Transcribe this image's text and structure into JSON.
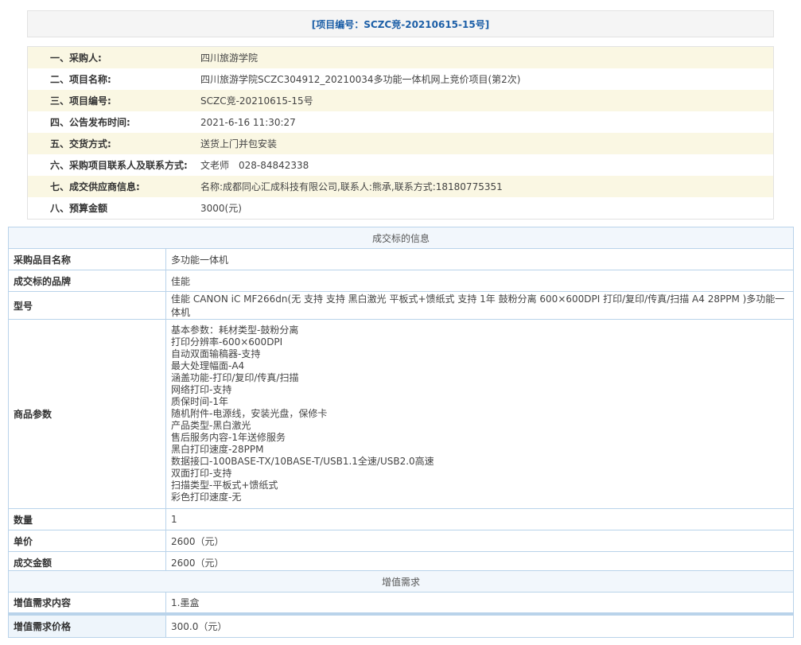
{
  "project_header": "[项目编号：SCZC竞-20210615-15号]",
  "info": [
    {
      "label": "一、采购人:",
      "value": "四川旅游学院"
    },
    {
      "label": "二、项目名称:",
      "value": "四川旅游学院SCZC304912_20210034多功能一体机网上竞价项目(第2次)"
    },
    {
      "label": "三、项目编号:",
      "value": "SCZC竞-20210615-15号"
    },
    {
      "label": "四、公告发布时间:",
      "value": "2021-6-16 11:30:27"
    },
    {
      "label": "五、交货方式:",
      "value": "送货上门并包安装"
    },
    {
      "label": "六、采购项目联系人及联系方式:",
      "value": "文老师　028-84842338"
    },
    {
      "label": "七、成交供应商信息:",
      "value": "名称:成都同心汇成科技有限公司,联系人:熊承,联系方式:18180775351"
    },
    {
      "label": "八、预算金额",
      "value": "3000(元)"
    }
  ],
  "deal": {
    "title": "成交标的信息",
    "item_name_label": "采购品目名称",
    "item_name": "多功能一体机",
    "brand_label": "成交标的品牌",
    "brand": "佳能",
    "model_label": "型号",
    "model": "佳能 CANON iC MF266dn(无 支持 支持 黑白激光 平板式+馈纸式 支持 1年 鼓粉分离 600×600DPI 打印/复印/传真/扫描 A4 28PPM )多功能一体机",
    "params_label": "商品参数",
    "params": [
      "基本参数：耗材类型-鼓粉分离",
      "打印分辨率-600×600DPI",
      "自动双面输稿器-支持",
      "最大处理幅面-A4",
      "涵盖功能-打印/复印/传真/扫描",
      "网络打印-支持",
      "质保时间-1年",
      "随机附件-电源线，安装光盘，保修卡",
      "产品类型-黑白激光",
      "售后服务内容-1年送修服务",
      "黑白打印速度-28PPM",
      "数据接口-100BASE-TX/10BASE-T/USB1.1全速/USB2.0高速",
      "双面打印-支持",
      "扫描类型-平板式+馈纸式",
      "彩色打印速度-无"
    ],
    "qty_label": "数量",
    "qty": "1",
    "unit_price_label": "单价",
    "unit_price": "2600（元）",
    "total_label": "成交金额",
    "total": "2600（元）"
  },
  "value_add": {
    "title": "增值需求",
    "content_label": "增值需求内容",
    "content": "1.墨盒",
    "price_label": "增值需求价格",
    "price": "300.0（元）"
  }
}
